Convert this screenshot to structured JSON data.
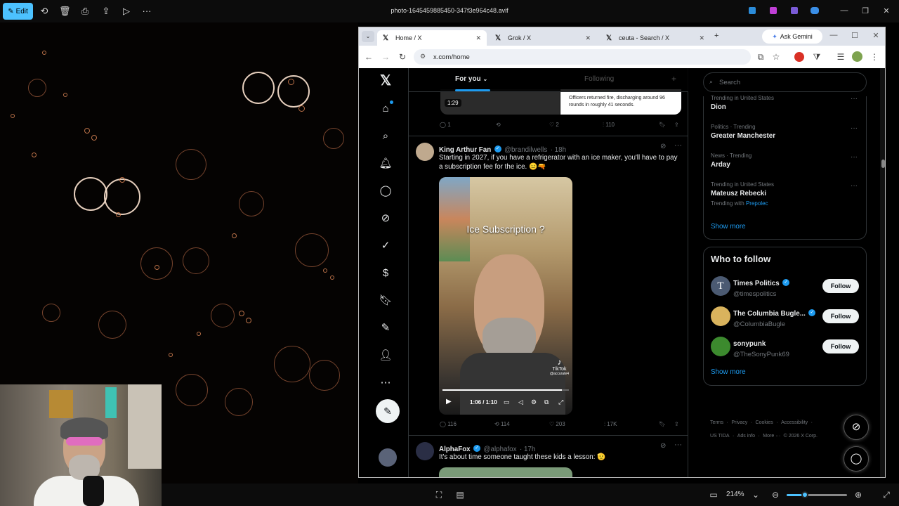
{
  "viewer": {
    "edit_label": "Edit",
    "filename": "photo-1645459885450-347f3e964c48.avif",
    "zoom": "214%"
  },
  "browser": {
    "tabs": [
      {
        "label": "Home / X",
        "active": true
      },
      {
        "label": "Grok / X",
        "active": false
      },
      {
        "label": "ceuta - Search / X",
        "active": false
      }
    ],
    "gemini_label": "Ask Gemini",
    "url": "x.com/home"
  },
  "feed": {
    "tab_foryou": "For you",
    "tab_following": "Following",
    "prev_tweet": {
      "video_time": "1:29",
      "card_text": "Officers returned fire, discharging around 96 rounds in roughly 41 seconds.",
      "replies": "1",
      "likes": "2",
      "views": "110"
    },
    "tweet1": {
      "name": "King Arthur Fan",
      "handle": "@brandilwells",
      "time": "· 18h",
      "text": "Starting in 2027, if you have a refrigerator with an ice maker, you'll have to pay a subscription fee for the ice. 😑🔫",
      "video_overlay": "Ice Subscription ?",
      "video_time": "1:06 / 1:10",
      "tiktok_label": "TikTok",
      "tiktok_handle": "@accurate4",
      "replies": "116",
      "retweets": "114",
      "likes": "203",
      "views": "17K"
    },
    "tweet2": {
      "name": "AlphaFox",
      "handle": "@alphafox",
      "time": "· 17h",
      "text": "It's about time someone taught these kids a lesson: 🫡"
    }
  },
  "sidebar": {
    "search_placeholder": "Search",
    "trends": [
      {
        "category": "Trending in United States",
        "name": "Dion",
        "extra": ""
      },
      {
        "category": "Politics · Trending",
        "name": "Greater Manchester",
        "extra": ""
      },
      {
        "category": "News · Trending",
        "name": "Arday",
        "extra": ""
      },
      {
        "category": "Trending in United States",
        "name": "Mateusz Rebecki",
        "extra_prefix": "Trending with",
        "extra": "Prepolec"
      }
    ],
    "show_more": "Show more",
    "who_to_follow_title": "Who to follow",
    "follow_suggestions": [
      {
        "name": "Times Politics",
        "handle": "@timespolitics",
        "button": "Follow"
      },
      {
        "name": "The Columbia Bugle...",
        "handle": "@ColumbiaBugle",
        "button": "Follow"
      },
      {
        "name": "sonypunk",
        "handle": "@TheSonyPunk69",
        "button": "Follow"
      }
    ],
    "show_more_2": "Show more",
    "footer": [
      "Terms",
      "Privacy",
      "Cookies",
      "Accessibility",
      "US TIDA",
      "Ads info",
      "More ···",
      "© 2026 X Corp."
    ]
  },
  "colors": {
    "accent": "#1d9bf0",
    "viewer_edit": "#4cc2ff"
  }
}
